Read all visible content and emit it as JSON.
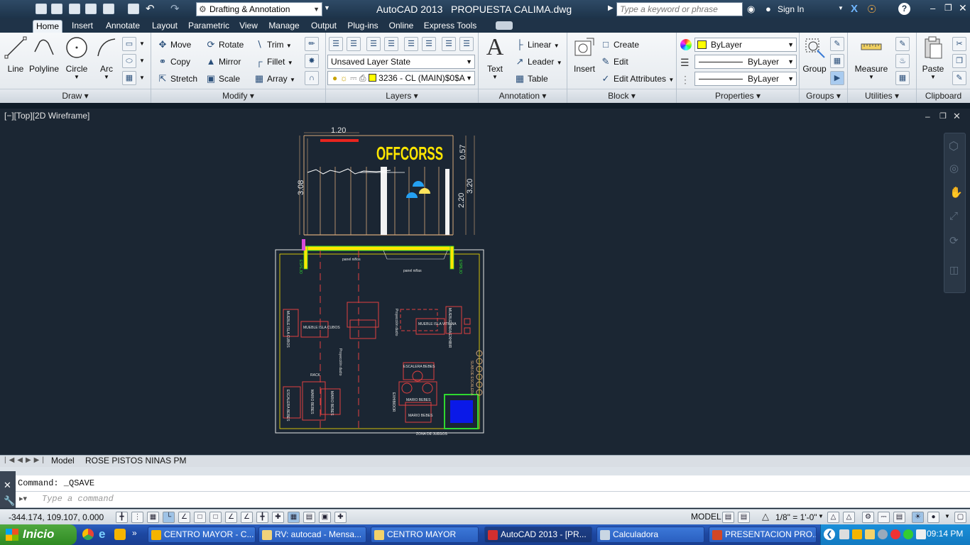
{
  "titlebar": {
    "workspace": "Drafting & Annotation",
    "app_title": "AutoCAD 2013   PROPUESTA CALIMA.dwg",
    "search_placeholder": "Type a keyword or phrase",
    "sign_in": "Sign In"
  },
  "ribbon_tabs": [
    "Home",
    "Insert",
    "Annotate",
    "Layout",
    "Parametric",
    "View",
    "Manage",
    "Output",
    "Plug-ins",
    "Online",
    "Express Tools"
  ],
  "draw": {
    "title": "Draw",
    "line": "Line",
    "polyline": "Polyline",
    "circle": "Circle",
    "arc": "Arc"
  },
  "modify": {
    "title": "Modify",
    "move": "Move",
    "rotate": "Rotate",
    "trim": "Trim",
    "copy": "Copy",
    "mirror": "Mirror",
    "fillet": "Fillet",
    "stretch": "Stretch",
    "scale": "Scale",
    "array": "Array"
  },
  "layers": {
    "title": "Layers",
    "layer_state": "Unsaved Layer State",
    "current_layer": "3236 - CL (MAIN)$0$A"
  },
  "annotation": {
    "title": "Annotation",
    "text": "Text",
    "linear": "Linear",
    "leader": "Leader",
    "table": "Table"
  },
  "block": {
    "title": "Block",
    "insert": "Insert",
    "create": "Create",
    "edit": "Edit",
    "edit_attributes": "Edit Attributes"
  },
  "properties": {
    "title": "Properties",
    "color": "ByLayer",
    "linetype": "ByLayer",
    "lineweight": "ByLayer",
    "color_swatch": "#ffff00"
  },
  "groups": {
    "title": "Groups",
    "group": "Group"
  },
  "utilities": {
    "title": "Utilities",
    "measure": "Measure"
  },
  "clipboard": {
    "title": "Clipboard",
    "paste": "Paste"
  },
  "viewport": {
    "label": "[−][Top][2D Wireframe]"
  },
  "drawing": {
    "dim_width": "1.20",
    "dim_057": "0.57",
    "dim_308": "3.08",
    "dim_320": "3.20",
    "dim_220": "2.20",
    "brand": "OFFCORSS",
    "espejo": "ESPEJO",
    "panel1": "panel niños",
    "panel2": "panel niñas",
    "mueble_isla1": "MUEBLE ISLA CUBOS",
    "mueble_isla2": "MUEBLE ISLA CUBOS",
    "mueble_vitrina": "MUEBLE ISLA VITRINA",
    "mueble_exhib": "MUEBLE PARA EXHIBIR",
    "rack": "RACK",
    "proyeccion": "Proyección ducto",
    "escalera1": "ESCALERA BEBES",
    "escalera2": "ESCALERA BEBES",
    "mario1": "MARIO BEBES",
    "mario2": "MARIO BEBES",
    "mario3": "MARIO BEBES",
    "mario4": "MARIO BEBES",
    "proyeccion2": "Proyección ducto",
    "exhibidor": "EXHIBIDOR",
    "zona_juegos": "ZONA DE JUEGOS",
    "slab_label": "SLAB DE ESCALERA"
  },
  "layout_tabs": [
    "Model",
    "ROSE PISTOS NINAS PM"
  ],
  "command": {
    "history": "Command: _QSAVE",
    "placeholder": "Type a command"
  },
  "status": {
    "coords": "-344.174, 109.107, 0.000",
    "model": "MODEL",
    "scale": "1/8\" = 1'-0\""
  },
  "taskbar": {
    "start": "Inicio",
    "tasks": [
      "CENTRO MAYOR - C...",
      "RV: autocad - Mensa...",
      "CENTRO MAYOR",
      "AutoCAD 2013 - [PR...",
      "Calculadora",
      "PRESENTACION PRO..."
    ],
    "clock": "09:14 PM"
  }
}
